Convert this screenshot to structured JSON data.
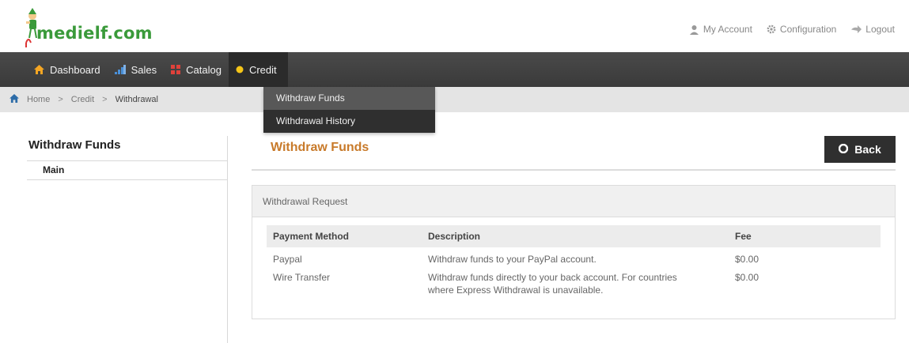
{
  "header": {
    "logo_text": "medielf.com",
    "links": [
      {
        "label": "My Account",
        "icon": "user-icon"
      },
      {
        "label": "Configuration",
        "icon": "gear-icon"
      },
      {
        "label": "Logout",
        "icon": "logout-arrow-icon"
      }
    ]
  },
  "nav": {
    "items": [
      {
        "label": "Dashboard",
        "icon": "home-icon",
        "color": "#f5a623"
      },
      {
        "label": "Sales",
        "icon": "bar-chart-icon",
        "color": "#4a90d9"
      },
      {
        "label": "Catalog",
        "icon": "catalog-grid-icon",
        "color": "#e0413a"
      },
      {
        "label": "Credit",
        "icon": "coin-icon",
        "color": "#f5c518"
      }
    ],
    "active": "Credit"
  },
  "dropdown": {
    "items": [
      "Withdraw Funds",
      "Withdrawal History"
    ]
  },
  "breadcrumb": {
    "items": [
      "Home",
      "Credit",
      "Withdrawal"
    ]
  },
  "sidebar": {
    "title": "Withdraw Funds",
    "items": [
      "Main"
    ]
  },
  "main": {
    "title": "Withdraw Funds",
    "title_color": "#c87a2a",
    "back_label": "Back",
    "panel_title": "Withdrawal Request",
    "table": {
      "headers": [
        "Payment Method",
        "Description",
        "Fee"
      ],
      "rows": [
        {
          "method": "Paypal",
          "desc_line1": "Withdraw funds to your PayPal account.",
          "desc_line2": "",
          "fee": "$0.00"
        },
        {
          "method": "Wire Transfer",
          "desc_line1": "Withdraw funds directly to your back account. For countries",
          "desc_line2": "where Express Withdrawal is unavailable.",
          "fee": "$0.00"
        }
      ]
    }
  }
}
